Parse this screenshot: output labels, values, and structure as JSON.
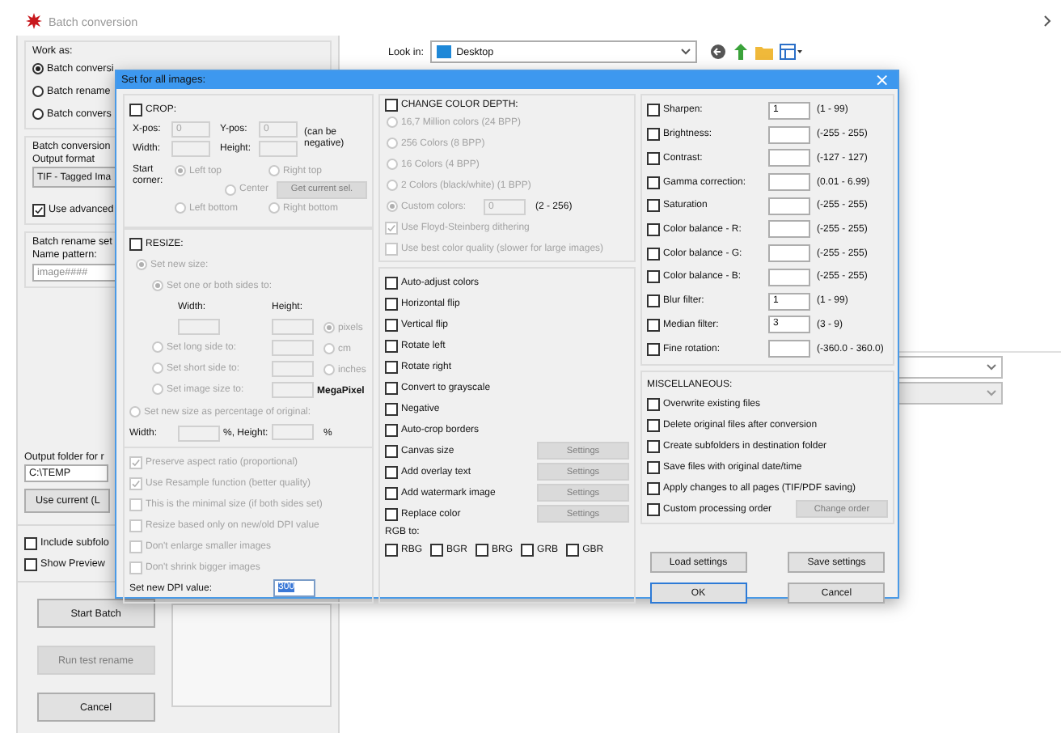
{
  "window": {
    "title": "Batch conversion"
  },
  "work_as": {
    "label": "Work as:",
    "options": [
      {
        "label": "Batch conversi",
        "selected": true
      },
      {
        "label": "Batch rename",
        "selected": false
      },
      {
        "label": "Batch convers",
        "selected": false
      }
    ]
  },
  "batch_conversion": {
    "label": "Batch conversion",
    "output_format_label": "Output format",
    "output_format": "TIF - Tagged Ima",
    "use_advanced": {
      "label": "Use advanced",
      "checked": true
    }
  },
  "batch_rename": {
    "label": "Batch rename set",
    "name_pattern_label": "Name pattern:",
    "name_pattern": {
      "value": "image####",
      "disabled": true
    }
  },
  "output_folder": {
    "label": "Output folder for r",
    "value": "C:\\TEMP",
    "button": "Use current (L"
  },
  "options": [
    {
      "label": "Include subfolo",
      "checked": false
    },
    {
      "label": "Show Preview",
      "checked": false
    }
  ],
  "actions": [
    {
      "label": "Start Batch",
      "disabled": false
    },
    {
      "label": "Run test rename",
      "disabled": true
    },
    {
      "label": "Cancel",
      "disabled": false
    }
  ],
  "look_in": {
    "label": "Look in:",
    "value": "Desktop"
  },
  "dialog": {
    "title": "Set for all images:",
    "close": "×",
    "crop": {
      "label": "CROP:",
      "checked": false,
      "xpos_label": "X-pos:",
      "xpos": "0",
      "ypos_label": "Y-pos:",
      "ypos": "0",
      "note": "(can be negative)",
      "width_label": "Width:",
      "height_label": "Height:",
      "corner_label": "Start corner:",
      "corners": [
        {
          "label": "Left top",
          "selected": true
        },
        {
          "label": "Right top",
          "selected": false
        },
        {
          "label": "Center",
          "selected": false
        },
        {
          "label": "Left bottom",
          "selected": false
        },
        {
          "label": "Right bottom",
          "selected": false
        }
      ],
      "get_button": {
        "label": "Get current sel.",
        "disabled": true
      }
    },
    "resize": {
      "label": "RESIZE:",
      "checked": false,
      "new_size": {
        "label": "Set new size:",
        "selected": true
      },
      "both_sides": {
        "label": "Set one or both sides to:",
        "selected": true
      },
      "width_label": "Width:",
      "height_label": "Height:",
      "sides": [
        {
          "label": "Set long side to:",
          "selected": false
        },
        {
          "label": "Set short side to:",
          "selected": false
        },
        {
          "label": "Set image size to:",
          "selected": false
        }
      ],
      "units": [
        {
          "label": "pixels",
          "selected": true
        },
        {
          "label": "cm",
          "selected": false
        },
        {
          "label": "inches",
          "selected": false
        }
      ],
      "megapixel": "MegaPixel",
      "percentage": {
        "label": "Set new size as percentage of original:",
        "selected": false
      },
      "pct_width_label": "Width:",
      "pct_height_label": "%, Height:",
      "pct_unit": "%",
      "flags": [
        {
          "label": "Preserve aspect ratio (proportional)",
          "checked": true
        },
        {
          "label": "Use Resample function (better quality)",
          "checked": true
        },
        {
          "label": "This is the minimal size (if both sides set)",
          "checked": false
        },
        {
          "label": "Resize based only on new/old DPI value",
          "checked": false
        },
        {
          "label": "Don't enlarge smaller images",
          "checked": false
        },
        {
          "label": "Don't shrink bigger images",
          "checked": false
        }
      ],
      "dpi_label": "Set new DPI value:",
      "dpi": "300"
    },
    "color_depth": {
      "label": "CHANGE COLOR DEPTH:",
      "checked": false,
      "options": [
        {
          "label": "16,7 Million colors (24 BPP)",
          "selected": false
        },
        {
          "label": "256 Colors (8 BPP)",
          "selected": false
        },
        {
          "label": "16 Colors (4 BPP)",
          "selected": false
        },
        {
          "label": "2 Colors (black/white) (1 BPP)",
          "selected": false
        },
        {
          "label": "Custom colors:",
          "selected": true
        }
      ],
      "custom_value": "0",
      "custom_range": "(2 - 256)",
      "flags": [
        {
          "label": "Use Floyd-Steinberg dithering",
          "checked": true
        },
        {
          "label": "Use best color quality (slower for large images)",
          "checked": false
        }
      ]
    },
    "effects": [
      {
        "kind": "check",
        "label": "Auto-adjust colors",
        "checked": false
      },
      {
        "kind": "check",
        "label": "Horizontal flip",
        "checked": false
      },
      {
        "kind": "check",
        "label": "Vertical flip",
        "checked": false
      },
      {
        "kind": "check",
        "label": "Rotate left",
        "checked": false
      },
      {
        "kind": "check",
        "label": "Rotate right",
        "checked": false
      },
      {
        "kind": "check",
        "label": "Convert to grayscale",
        "checked": false
      },
      {
        "kind": "check",
        "label": "Negative",
        "checked": false
      },
      {
        "kind": "check",
        "label": "Auto-crop borders",
        "checked": false
      },
      {
        "kind": "settings",
        "label": "Canvas size",
        "checked": false,
        "button": {
          "label": "Settings",
          "disabled": true
        }
      },
      {
        "kind": "settings",
        "label": "Add overlay text",
        "checked": false,
        "button": {
          "label": "Settings",
          "disabled": true
        }
      },
      {
        "kind": "settings",
        "label": "Add watermark image",
        "checked": false,
        "button": {
          "label": "Settings",
          "disabled": true
        }
      },
      {
        "kind": "settings",
        "label": "Replace color",
        "checked": false,
        "button": {
          "label": "Settings",
          "disabled": true
        }
      }
    ],
    "rgb_label": "RGB to:",
    "rgb": [
      {
        "label": "RBG",
        "checked": false
      },
      {
        "label": "BGR",
        "checked": false
      },
      {
        "label": "BRG",
        "checked": false
      },
      {
        "label": "GRB",
        "checked": false
      },
      {
        "label": "GBR",
        "checked": false
      }
    ],
    "adjustments": [
      {
        "label": "Sharpen:",
        "checked": false,
        "value": "1",
        "range": "(1 - 99)"
      },
      {
        "label": "Brightness:",
        "checked": false,
        "range": "(-255 - 255)"
      },
      {
        "label": "Contrast:",
        "checked": false,
        "range": "(-127 - 127)"
      },
      {
        "label": "Gamma correction:",
        "checked": false,
        "range": "(0.01 - 6.99)"
      },
      {
        "label": "Saturation",
        "checked": false,
        "range": "(-255 - 255)"
      },
      {
        "label": "Color balance - R:",
        "checked": false,
        "range": "(-255 - 255)"
      },
      {
        "label": "Color balance - G:",
        "checked": false,
        "range": "(-255 - 255)"
      },
      {
        "label": "Color balance - B:",
        "checked": false,
        "range": "(-255 - 255)"
      },
      {
        "label": "Blur filter:",
        "checked": false,
        "value": "1",
        "range": "(1 - 99)"
      },
      {
        "label": "Median filter:",
        "checked": false,
        "value": "3",
        "range": "(3 - 9)"
      },
      {
        "label": "Fine rotation:",
        "checked": false,
        "range": "(-360.0 - 360.0)"
      }
    ],
    "misc": {
      "label": "MISCELLANEOUS:",
      "items": [
        {
          "kind": "check",
          "label": "Overwrite existing files",
          "checked": false
        },
        {
          "kind": "check",
          "label": "Delete original files after conversion",
          "checked": false
        },
        {
          "kind": "check",
          "label": "Create subfolders in destination folder",
          "checked": false
        },
        {
          "kind": "check",
          "label": "Save files with original date/time",
          "checked": false
        },
        {
          "kind": "check",
          "label": "Apply changes to all pages (TIF/PDF saving)",
          "checked": false
        },
        {
          "kind": "settings",
          "label": "Custom processing order",
          "checked": false,
          "button": {
            "label": "Change order",
            "disabled": true
          }
        }
      ]
    },
    "buttons": [
      {
        "label": "Load settings",
        "default": false
      },
      {
        "label": "Save settings",
        "default": false
      },
      {
        "label": "OK",
        "default": true
      },
      {
        "label": "Cancel",
        "default": false
      }
    ]
  }
}
